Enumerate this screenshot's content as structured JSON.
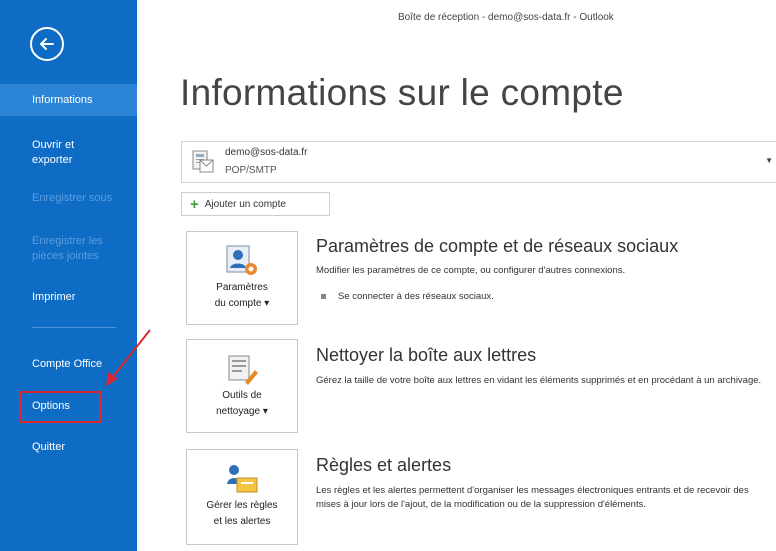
{
  "window": {
    "title": "Boîte de réception - demo@sos-data.fr - Outlook"
  },
  "sidebar": {
    "items": [
      {
        "label": "Informations"
      },
      {
        "label": "Ouvrir et exporter"
      },
      {
        "label": "Enregistrer sous"
      },
      {
        "label": "Enregistrer les pièces jointes"
      },
      {
        "label": "Imprimer"
      },
      {
        "label": "Compte Office"
      },
      {
        "label": "Options"
      },
      {
        "label": "Quitter"
      }
    ]
  },
  "main": {
    "title": "Informations sur le compte",
    "account": {
      "email": "demo@sos-data.fr",
      "type": "POP/SMTP"
    },
    "add_account_label": "Ajouter un compte",
    "sections": [
      {
        "tile_label": "Paramètres\ndu compte ▾",
        "title": "Paramètres de compte et de réseaux sociaux",
        "description": "Modifier les paramètres de ce compte, ou configurer d'autres connexions.",
        "link": "Se connecter à des réseaux sociaux."
      },
      {
        "tile_label": "Outils de\nnettoyage ▾",
        "title": "Nettoyer la boîte aux lettres",
        "description": "Gérez la taille de votre boîte aux lettres en vidant les éléments supprimés et en procédant à un archivage."
      },
      {
        "tile_label": "Gérer les règles\net les alertes",
        "title": "Règles et alertes",
        "description": "Les règles et les alertes permettent d'organiser les messages électroniques entrants et de recevoir des mises à jour lors de l'ajout, de la modification ou de la suppression d'éléments."
      }
    ]
  },
  "colors": {
    "sidebar": "#0f6cc5",
    "sidebar_active": "#2b84d6",
    "highlight": "#d9282f"
  }
}
